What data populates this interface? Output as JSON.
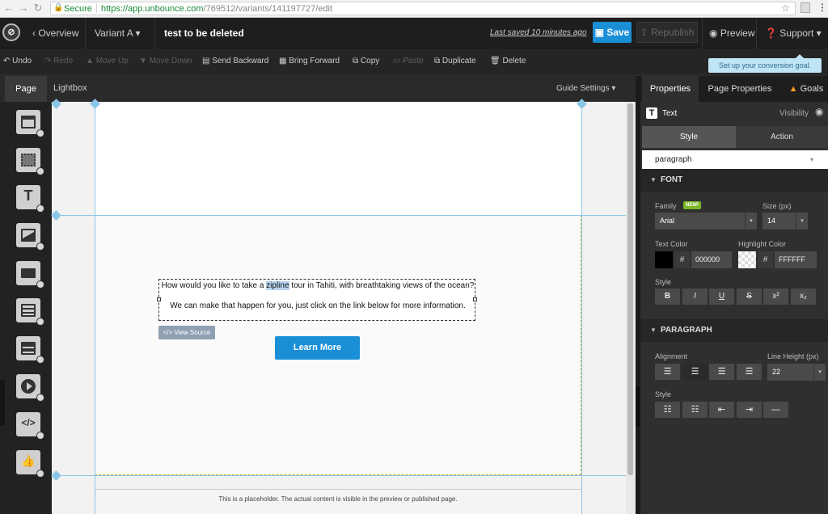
{
  "browser": {
    "secure_label": "Secure",
    "url_host": "https://app.unbounce.com",
    "url_path": "/769512/variants/141197727/edit"
  },
  "topnav": {
    "overview": "Overview",
    "variant": "Variant A",
    "page_name": "test to be deleted",
    "last_saved": "Last saved  10 minutes ago",
    "save": "Save",
    "republish": "Republish",
    "preview": "Preview",
    "support": "Support"
  },
  "toolbar": {
    "undo": "Undo",
    "redo": "Redo",
    "move_up": "Move Up",
    "move_down": "Move Down",
    "send_backward": "Send Backward",
    "bring_forward": "Bring Forward",
    "copy": "Copy",
    "paste": "Paste",
    "duplicate": "Duplicate",
    "delete": "Delete"
  },
  "tooltip": "Set up your conversion goal.",
  "left_tabs": {
    "page": "Page",
    "lightbox": "Lightbox",
    "guide_settings": "Guide Settings"
  },
  "canvas": {
    "paragraph1_before": "How would you like to take a ",
    "paragraph1_highlight": "zipline",
    "paragraph1_after": " tour in Tahiti, with breathtaking views of the ocean?",
    "paragraph2": "We can make that happen for you, just click on the link below for more information.",
    "view_source": "</> View Source",
    "button": "Learn More",
    "placeholder": "This is a placeholder. The actual content is visible in the preview or published page."
  },
  "right_panel": {
    "tabs": [
      "Properties",
      "Page Properties",
      "Goals"
    ],
    "element_type": "Text",
    "visibility": "Visibility",
    "style_tab": "Style",
    "action_tab": "Action",
    "style_select": "paragraph",
    "font_section": "FONT",
    "family_label": "Family",
    "new_badge": "NEW!",
    "family_value": "Arial",
    "size_label": "Size (px)",
    "size_value": "14",
    "text_color_label": "Text Color",
    "text_color_hex": "000000",
    "highlight_color_label": "Highlight Color",
    "highlight_color_hex": "FFFFFF",
    "style_label": "Style",
    "style_buttons": [
      "B",
      "I",
      "U",
      "S",
      "x²",
      "x₂"
    ],
    "paragraph_section": "PARAGRAPH",
    "alignment_label": "Alignment",
    "line_height_label": "Line Height (px)",
    "line_height_value": "22",
    "para_style_label": "Style"
  },
  "colors": {
    "accent": "#1a8fd6",
    "guide": "#8cc6e6",
    "lightbox_border": "#b8b232"
  }
}
